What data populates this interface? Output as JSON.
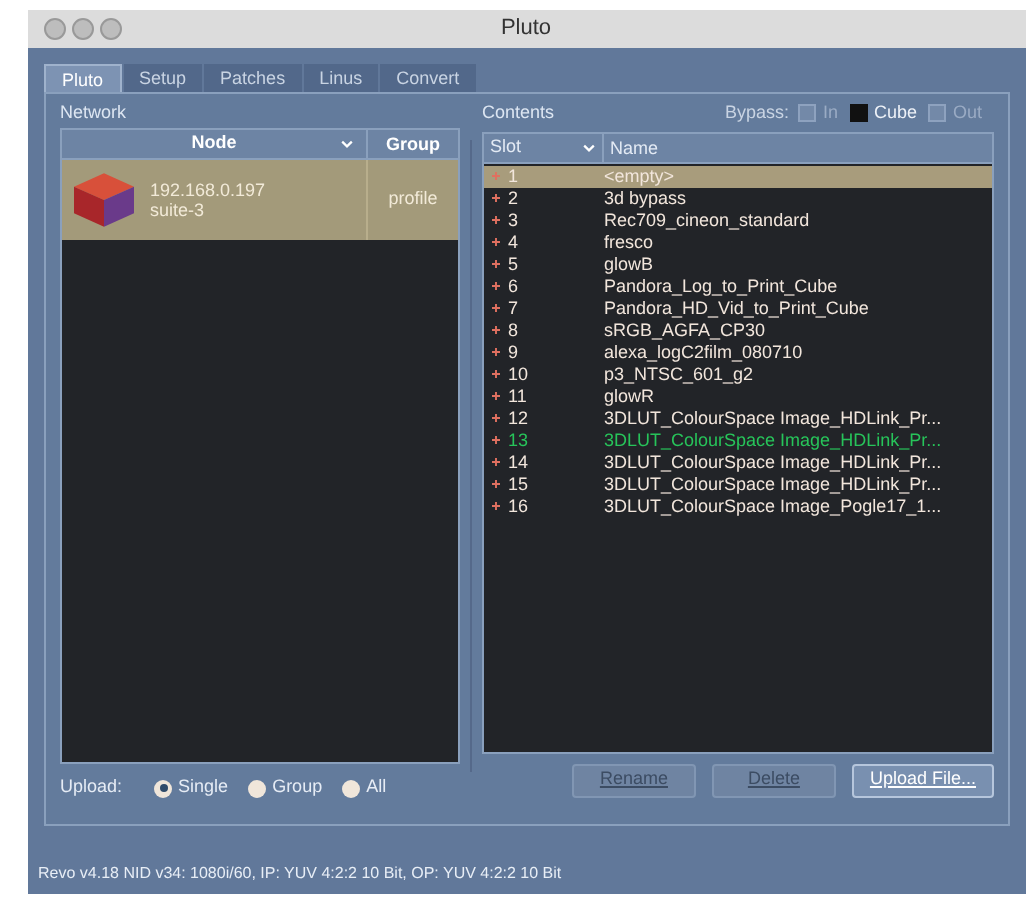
{
  "window": {
    "title": "Pluto"
  },
  "tabs": [
    {
      "label": "Pluto",
      "selected": true
    },
    {
      "label": "Setup",
      "selected": false
    },
    {
      "label": "Patches",
      "selected": false
    },
    {
      "label": "Linus",
      "selected": false
    },
    {
      "label": "Convert",
      "selected": false
    }
  ],
  "network": {
    "title": "Network",
    "columns": [
      "Node",
      "Group"
    ],
    "rows": [
      {
        "address": "192.168.0.197",
        "host": "suite-3",
        "group": "profile",
        "selected": true
      }
    ],
    "upload_label": "Upload:",
    "upload_options": [
      {
        "label": "Single",
        "selected": true
      },
      {
        "label": "Group",
        "selected": false
      },
      {
        "label": "All",
        "selected": false
      }
    ]
  },
  "contents": {
    "title": "Contents",
    "bypass_label": "Bypass:",
    "bypass": [
      {
        "label": "In",
        "checked": false
      },
      {
        "label": "Cube",
        "checked": true
      },
      {
        "label": "Out",
        "checked": false
      }
    ],
    "columns": [
      "Slot",
      "Name"
    ],
    "rows": [
      {
        "slot": "1",
        "name": "<empty>",
        "selected": true,
        "active": false
      },
      {
        "slot": "2",
        "name": "3d bypass",
        "selected": false,
        "active": false
      },
      {
        "slot": "3",
        "name": "Rec709_cineon_standard",
        "selected": false,
        "active": false
      },
      {
        "slot": "4",
        "name": "fresco",
        "selected": false,
        "active": false
      },
      {
        "slot": "5",
        "name": "glowB",
        "selected": false,
        "active": false
      },
      {
        "slot": "6",
        "name": "Pandora_Log_to_Print_Cube",
        "selected": false,
        "active": false
      },
      {
        "slot": "7",
        "name": "Pandora_HD_Vid_to_Print_Cube",
        "selected": false,
        "active": false
      },
      {
        "slot": "8",
        "name": "sRGB_AGFA_CP30",
        "selected": false,
        "active": false
      },
      {
        "slot": "9",
        "name": "alexa_logC2film_080710",
        "selected": false,
        "active": false
      },
      {
        "slot": "10",
        "name": "p3_NTSC_601_g2",
        "selected": false,
        "active": false
      },
      {
        "slot": "11",
        "name": "glowR",
        "selected": false,
        "active": false
      },
      {
        "slot": "12",
        "name": "3DLUT_ColourSpace Image_HDLink_Pr...",
        "selected": false,
        "active": false
      },
      {
        "slot": "13",
        "name": "3DLUT_ColourSpace Image_HDLink_Pr...",
        "selected": false,
        "active": true
      },
      {
        "slot": "14",
        "name": "3DLUT_ColourSpace Image_HDLink_Pr...",
        "selected": false,
        "active": false
      },
      {
        "slot": "15",
        "name": "3DLUT_ColourSpace Image_HDLink_Pr...",
        "selected": false,
        "active": false
      },
      {
        "slot": "16",
        "name": "3DLUT_ColourSpace Image_Pogle17_1...",
        "selected": false,
        "active": false
      }
    ],
    "buttons": [
      {
        "label": "Rename",
        "disabled": true
      },
      {
        "label": "Delete",
        "disabled": true
      },
      {
        "label": "Upload File...",
        "disabled": false
      }
    ]
  },
  "status_bar": "Revo v4.18 NID v34: 1080i/60, IP: YUV 4:2:2 10 Bit, OP: YUV 4:2:2 10 Bit"
}
